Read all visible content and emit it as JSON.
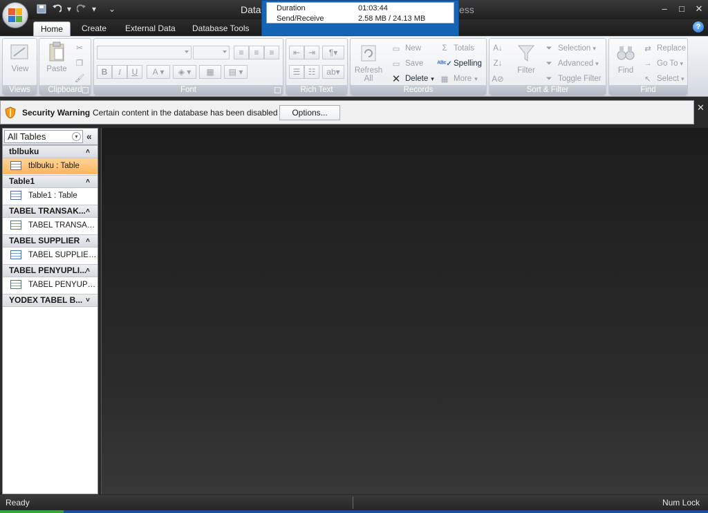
{
  "titlebar": {
    "title_left": "Datal",
    "title_right": "ess",
    "win_controls": [
      "–",
      "□",
      "✕"
    ]
  },
  "transfer_popup": {
    "rows": [
      {
        "label": "Duration",
        "value": "01:03:44"
      },
      {
        "label": "Send/Receive",
        "value": "2.58 MB / 24.13 MB"
      }
    ]
  },
  "tabs": [
    "Home",
    "Create",
    "External Data",
    "Database Tools"
  ],
  "help_label": "?",
  "ribbon": {
    "views": {
      "label": "Views",
      "view_btn": "View"
    },
    "clipboard": {
      "label": "Clipboard",
      "paste_btn": "Paste"
    },
    "font": {
      "label": "Font",
      "bold": "B",
      "italic": "I",
      "underline": "U",
      "font_color": "A"
    },
    "rich_text": {
      "label": "Rich Text"
    },
    "records": {
      "label": "Records",
      "refresh_line1": "Refresh",
      "refresh_line2": "All",
      "new": "New",
      "save": "Save",
      "delete": "Delete",
      "totals": "Totals",
      "spelling": "Spelling",
      "more": "More"
    },
    "sort_filter": {
      "label": "Sort & Filter",
      "filter": "Filter",
      "selection": "Selection",
      "advanced": "Advanced",
      "toggle_filter": "Toggle Filter"
    },
    "find": {
      "label": "Find",
      "find_btn": "Find",
      "replace": "Replace",
      "go_to": "Go To",
      "select": "Select"
    }
  },
  "security": {
    "title": "Security Warning",
    "message": "Certain content in the database has been disabled",
    "options_btn": "Options..."
  },
  "nav": {
    "title": "All Tables",
    "groups": [
      {
        "name": "tblbuku",
        "item": "tblbuku : Table",
        "chev": "˄"
      },
      {
        "name": "Table1",
        "item": "Table1 : Table",
        "chev": "˄"
      },
      {
        "name": "TABEL TRANSAK...",
        "item": "TABEL TRANSAK...",
        "chev": "˄"
      },
      {
        "name": "TABEL SUPPLIER",
        "item": "TABEL SUPPLIER ...",
        "chev": "˄"
      },
      {
        "name": "TABEL PENYUPLI...",
        "item": "TABEL PENYUPLI...",
        "chev": "˄"
      },
      {
        "name": "YODEX TABEL B...",
        "chev": "˅"
      }
    ]
  },
  "status": {
    "left": "Ready",
    "right": "Num Lock"
  }
}
